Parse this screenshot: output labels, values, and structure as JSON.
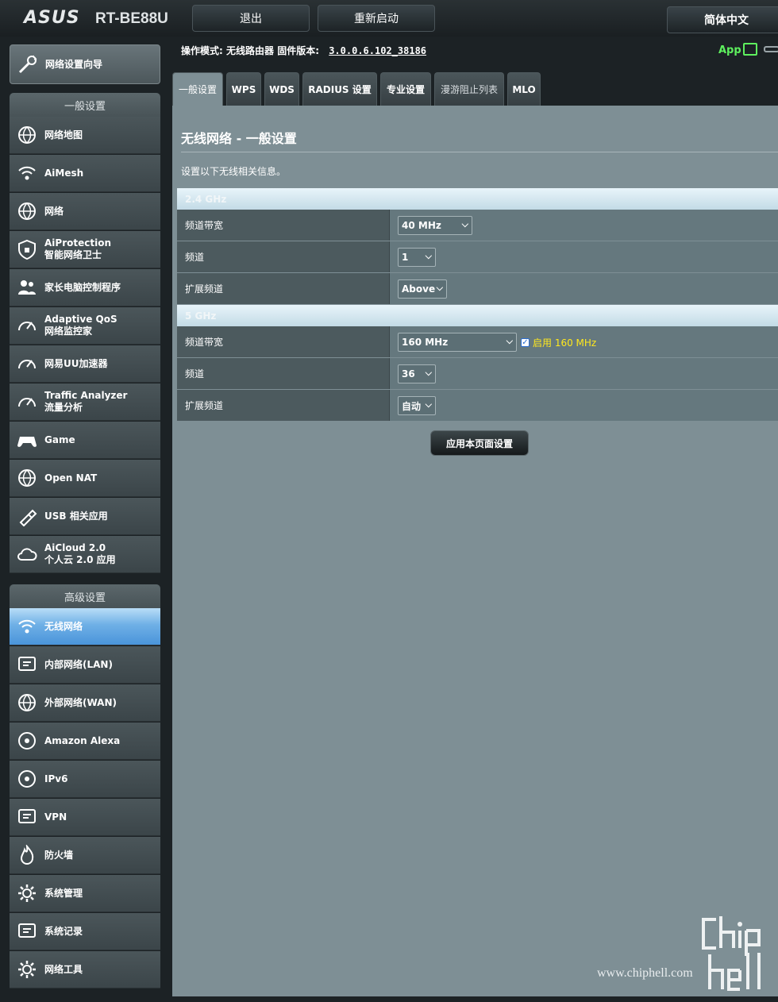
{
  "header": {
    "brand": "ASUS",
    "model": "RT-BE88U",
    "logout_label": "退出",
    "reboot_label": "重新启动",
    "language": "简体中文",
    "mode_label": "操作模式:",
    "mode_value": "无线路由器",
    "firmware_label": "固件版本:",
    "firmware_value": "3.0.0.6.102_38186",
    "app_label": "App"
  },
  "sidebar": {
    "wizard_label": "网络设置向导",
    "general_title": "一般设置",
    "general_items": [
      {
        "line1": "网络地图",
        "line2": "",
        "icon": "network-map-icon"
      },
      {
        "line1": "AiMesh",
        "line2": "",
        "icon": "aimesh-icon"
      },
      {
        "line1": "网络",
        "line2": "",
        "icon": "globe-network-icon"
      },
      {
        "line1": "AiProtection",
        "line2": "智能网络卫士",
        "icon": "shield-icon"
      },
      {
        "line1": "家长电脑控制程序",
        "line2": "",
        "icon": "parental-control-icon"
      },
      {
        "line1": "Adaptive QoS",
        "line2": "网络监控家",
        "icon": "gauge-icon"
      },
      {
        "line1": "网易UU加速器",
        "line2": "",
        "icon": "speedometer-icon"
      },
      {
        "line1": "Traffic Analyzer",
        "line2": "流量分析",
        "icon": "traffic-analyzer-icon"
      },
      {
        "line1": "Game",
        "line2": "",
        "icon": "gamepad-icon"
      },
      {
        "line1": "Open NAT",
        "line2": "",
        "icon": "open-nat-icon"
      },
      {
        "line1": "USB 相关应用",
        "line2": "",
        "icon": "usb-icon"
      },
      {
        "line1": "AiCloud 2.0",
        "line2": "个人云 2.0 应用",
        "icon": "cloud-icon"
      }
    ],
    "advanced_title": "高级设置",
    "advanced_items": [
      {
        "line1": "无线网络",
        "line2": "",
        "icon": "wireless-icon",
        "active": true
      },
      {
        "line1": "内部网络(LAN)",
        "line2": "",
        "icon": "lan-icon"
      },
      {
        "line1": "外部网络(WAN)",
        "line2": "",
        "icon": "wan-globe-icon"
      },
      {
        "line1": "Amazon Alexa",
        "line2": "",
        "icon": "alexa-icon"
      },
      {
        "line1": "IPv6",
        "line2": "",
        "icon": "ipv6-icon"
      },
      {
        "line1": "VPN",
        "line2": "",
        "icon": "vpn-icon"
      },
      {
        "line1": "防火墙",
        "line2": "",
        "icon": "firewall-icon"
      },
      {
        "line1": "系统管理",
        "line2": "",
        "icon": "system-admin-icon"
      },
      {
        "line1": "系统记录",
        "line2": "",
        "icon": "system-log-icon"
      },
      {
        "line1": "网络工具",
        "line2": "",
        "icon": "network-tools-icon"
      }
    ]
  },
  "tabs": [
    "一般设置",
    "WPS",
    "WDS",
    "RADIUS 设置",
    "专业设置",
    "漫游阻止列表",
    "MLO"
  ],
  "main": {
    "title": "无线网络 - 一般设置",
    "description": "设置以下无线相关信息。",
    "band24": {
      "title": "2.4 GHz",
      "rows": [
        {
          "label": "频道带宽",
          "value": "40  MHz"
        },
        {
          "label": "频道",
          "value": "1"
        },
        {
          "label": "扩展频道",
          "value": "Above"
        }
      ]
    },
    "band5": {
      "title": "5 GHz",
      "rows": [
        {
          "label": "频道带宽",
          "value": "160  MHz"
        },
        {
          "label": "频道",
          "value": "36"
        },
        {
          "label": "扩展频道",
          "value": "自动"
        }
      ],
      "enable160_label": "启用 160 MHz",
      "enable160_checked": true
    },
    "apply_label": "应用本页面设置"
  },
  "watermark": {
    "url": "www.chiphell.com"
  }
}
